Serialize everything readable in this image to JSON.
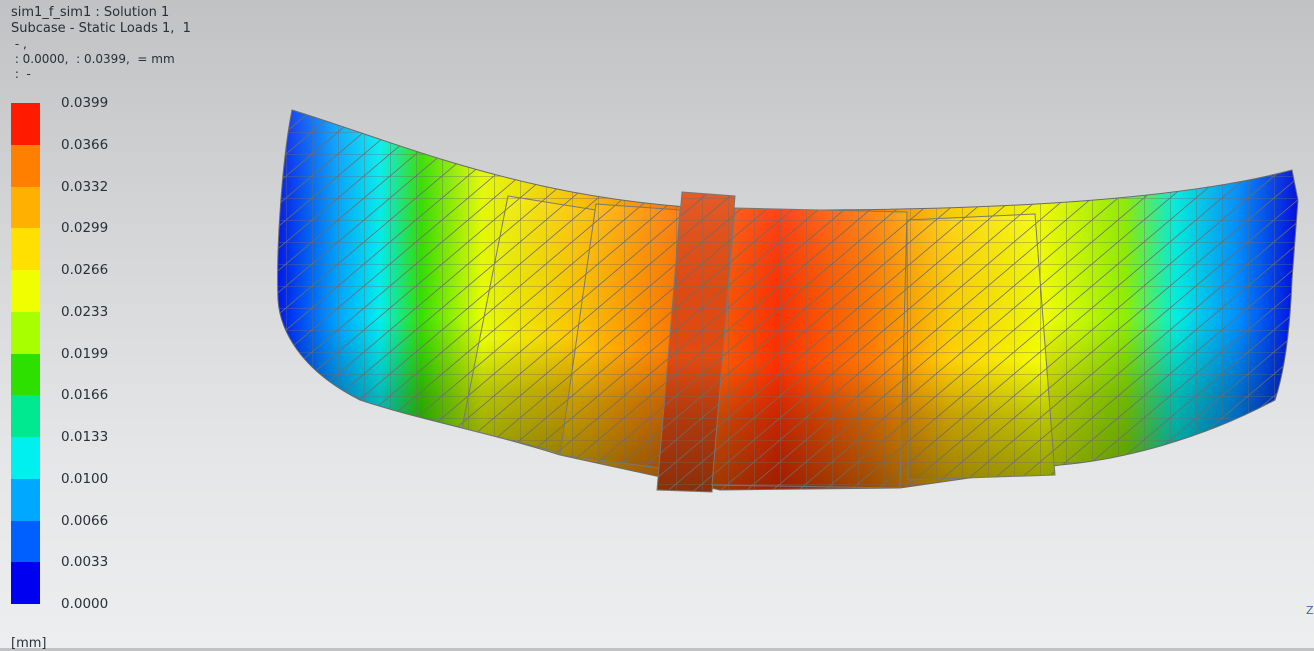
{
  "header": {
    "line1": "sim1_f_sim1 : Solution 1",
    "line2": "Subcase - Static Loads 1,  1",
    "line3": " - ,",
    "line4": " : 0.0000,  : 0.0399,  = mm",
    "line5": " :  -"
  },
  "legend": {
    "colors": [
      "#ff1a00",
      "#ff7f00",
      "#ffb000",
      "#ffe000",
      "#f0ff00",
      "#a8ff00",
      "#2de000",
      "#00e890",
      "#00f0f0",
      "#00a8ff",
      "#0060ff",
      "#0000f0"
    ],
    "labels": [
      "0.0399",
      "0.0366",
      "0.0332",
      "0.0299",
      "0.0266",
      "0.0233",
      "0.0199",
      "0.0166",
      "0.0133",
      "0.0100",
      "0.0066",
      "0.0033",
      "0.0000"
    ],
    "unit": "[mm]"
  },
  "axis_label": "Z"
}
